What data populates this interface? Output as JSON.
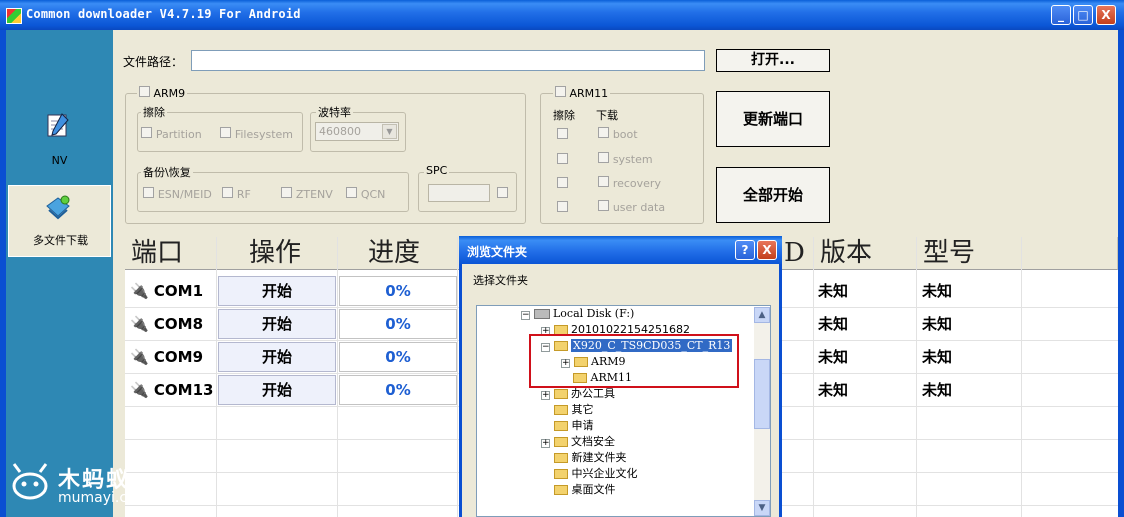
{
  "window": {
    "title": "Common downloader V4.7.19 For Android",
    "minimize": "_",
    "maximize": "□",
    "close": "X"
  },
  "nav": {
    "items": [
      {
        "label": "NV",
        "icon": "notebook-icon"
      },
      {
        "label": "多文件下载",
        "icon": "download-icon"
      }
    ]
  },
  "path": {
    "label": "文件路径：",
    "value": "",
    "open_button": "打开..."
  },
  "arm9": {
    "label": "ARM9",
    "erase_label": "擦除",
    "partition": "Partition",
    "filesystem": "Filesystem",
    "baud_label": "波特率",
    "baud_value": "460800",
    "backup_label": "备份\\恢复",
    "esn": "ESN/MEID",
    "rf": "RF",
    "ztenv": "ZTENV",
    "qcn": "QCN",
    "spc_label": "SPC"
  },
  "arm11": {
    "label": "ARM11",
    "erase_label": "擦除",
    "download_label": "下载",
    "items": [
      "boot",
      "system",
      "recovery",
      "user data"
    ]
  },
  "buttons": {
    "update_ports": "更新端口",
    "start_all": "全部开始"
  },
  "grid": {
    "columns": [
      "端口",
      "操作",
      "进度",
      "D",
      "版本",
      "型号"
    ],
    "rows": [
      {
        "port": "COM1",
        "action": "开始",
        "progress": "0%",
        "version": "未知",
        "model": "未知"
      },
      {
        "port": "COM8",
        "action": "开始",
        "progress": "0%",
        "version": "未知",
        "model": "未知"
      },
      {
        "port": "COM9",
        "action": "开始",
        "progress": "0%",
        "version": "未知",
        "model": "未知"
      },
      {
        "port": "COM13",
        "action": "开始",
        "progress": "0%",
        "version": "未知",
        "model": "未知"
      }
    ]
  },
  "dialog": {
    "title": "浏览文件夹",
    "help": "?",
    "close": "X",
    "prompt": "选择文件夹",
    "tree": [
      {
        "label": "Local Disk (F:)",
        "kind": "drive",
        "expander": "−"
      },
      {
        "label": "20101022154251682",
        "kind": "folder",
        "expander": "+"
      },
      {
        "label": "X920_C_TS9CD035_CT_R13",
        "kind": "folder",
        "expander": "−",
        "selected": true
      },
      {
        "label": "ARM9",
        "kind": "folder",
        "expander": "+"
      },
      {
        "label": "ARM11",
        "kind": "folder",
        "expander": ""
      },
      {
        "label": "办公工具",
        "kind": "folder",
        "expander": "+"
      },
      {
        "label": "其它",
        "kind": "folder",
        "expander": ""
      },
      {
        "label": "申请",
        "kind": "folder",
        "expander": ""
      },
      {
        "label": "文档安全",
        "kind": "folder",
        "expander": "+"
      },
      {
        "label": "新建文件夹",
        "kind": "folder",
        "expander": ""
      },
      {
        "label": "中兴企业文化",
        "kind": "folder",
        "expander": ""
      },
      {
        "label": "桌面文件",
        "kind": "folder",
        "expander": ""
      }
    ]
  },
  "watermark": {
    "brand": "木蚂蚁",
    "url": "mumayi.com"
  },
  "colors": {
    "titlebar": "#0a5fd8",
    "nav_bg": "#2e88b4",
    "progress_text": "#1e5fd2",
    "highlight_box": "#d0101a",
    "selection": "#316ac5"
  }
}
